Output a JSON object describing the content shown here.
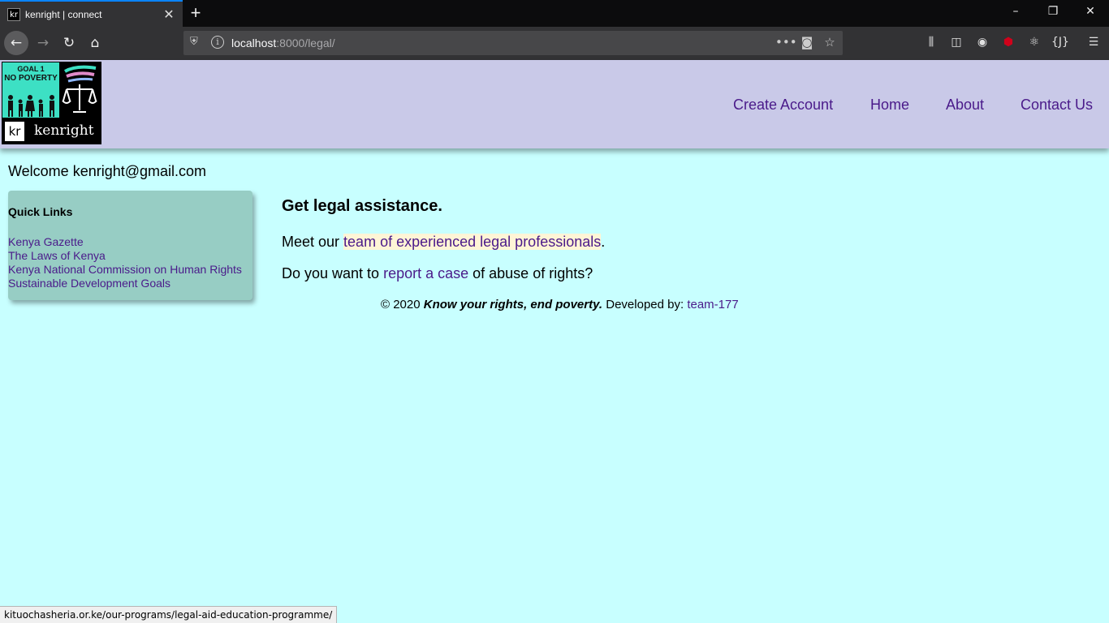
{
  "browser": {
    "tab_title": "kenright | connect",
    "tab_favicon": "kr",
    "url_host": "localhost",
    "url_path": ":8000/legal/",
    "status_url": "kituochasheria.or.ke/our-programs/legal-aid-education-programme/",
    "icons": {
      "back": "back-arrow-icon",
      "forward": "forward-arrow-icon",
      "reload": "reload-icon",
      "home": "home-icon",
      "shield": "tracking-shield-icon",
      "info": "info-icon",
      "more": "more-actions-icon",
      "pocket": "pocket-icon",
      "bookmark": "star-icon",
      "library": "library-icon",
      "sidebar": "sidebar-icon",
      "account": "account-icon",
      "ublock": "ublock-icon",
      "react": "react-devtools-icon",
      "json": "json-viewer-icon",
      "menu": "hamburger-menu-icon"
    }
  },
  "site": {
    "logo": {
      "goal_label": "GOAL 1",
      "goal_title": "NO POVERTY",
      "badge": "kr",
      "name": "kenright"
    },
    "nav": [
      "Create Account",
      "Home",
      "About",
      "Contact Us"
    ],
    "colors": {
      "header_bg": "#c9c9e8",
      "page_bg": "#c8ffff",
      "link": "#4a1a8a",
      "sidebar_bg": "#97cdc4"
    }
  },
  "welcome": "Welcome kenright@gmail.com",
  "quick_links": {
    "title": "Quick Links",
    "items": [
      "Kenya Gazette",
      "The Laws of Kenya",
      "Kenya National Commission on Human Rights",
      "Sustainable Development Goals"
    ]
  },
  "main": {
    "heading": "Get legal assistance.",
    "meet_prefix": "Meet our ",
    "meet_link": "team of experienced legal professionals",
    "meet_suffix": ".",
    "report_prefix": "Do you want to ",
    "report_link": "report a case",
    "report_suffix": " of abuse of rights?"
  },
  "footer": {
    "copyright": "© 2020 ",
    "slogan": "Know your rights, end poverty.",
    "dev_label": " Developed by: ",
    "dev_link": "team-177"
  }
}
